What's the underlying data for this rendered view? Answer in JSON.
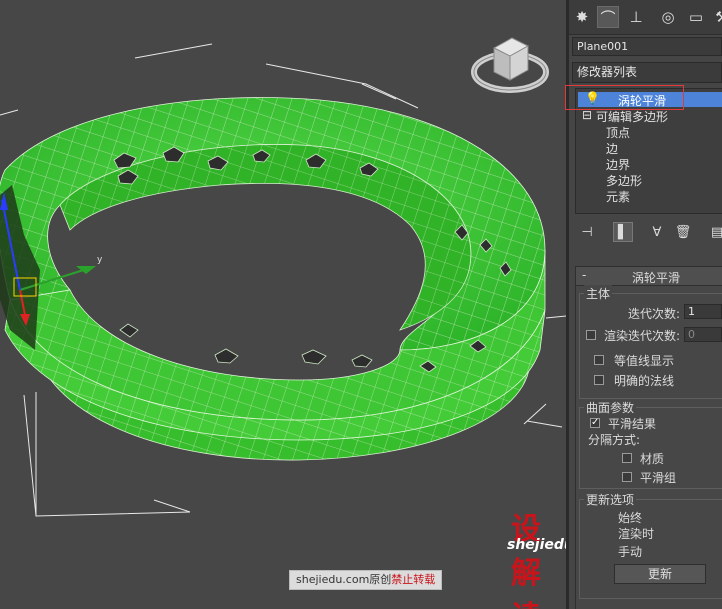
{
  "toolbar_tabs": [
    {
      "icon": "create-tab-icon",
      "glyph": "✸"
    },
    {
      "icon": "modify-tab-icon",
      "glyph": "⌒"
    },
    {
      "icon": "hierarchy-tab-icon",
      "glyph": "⊥"
    },
    {
      "icon": "motion-tab-icon",
      "glyph": "◎"
    },
    {
      "icon": "display-tab-icon",
      "glyph": "▭"
    },
    {
      "icon": "utilities-tab-icon",
      "glyph": "⚒"
    }
  ],
  "object_name": "Plane001",
  "modifier_list_label": "修改器列表",
  "modifier_stack": {
    "selected": "涡轮平滑",
    "base": "可编辑多边形",
    "subobjects": [
      "顶点",
      "边",
      "边界",
      "多边形",
      "元素"
    ]
  },
  "rollout": {
    "title": "涡轮平滑",
    "main_group": "主体",
    "iterations_label": "迭代次数:",
    "iterations_value": "1",
    "render_iters_label": "渲染迭代次数:",
    "render_iters_value": "0",
    "isoline_label": "等值线显示",
    "explicit_normals_label": "明确的法线",
    "surface_group": "曲面参数",
    "smooth_result_label": "平滑结果",
    "separate_by_label": "分隔方式:",
    "materials_label": "材质",
    "smoothing_groups_label": "平滑组",
    "update_group": "更新选项",
    "always_label": "始终",
    "when_rendering_label": "渲染时",
    "manually_label": "手动",
    "update_button": "更新"
  },
  "gizmo_axis_label": "y",
  "watermark": {
    "logo": "设解读",
    "url": "shejiedu.com"
  },
  "credit": {
    "text": "shejiedu.com原创",
    "warning": "禁止转载"
  }
}
